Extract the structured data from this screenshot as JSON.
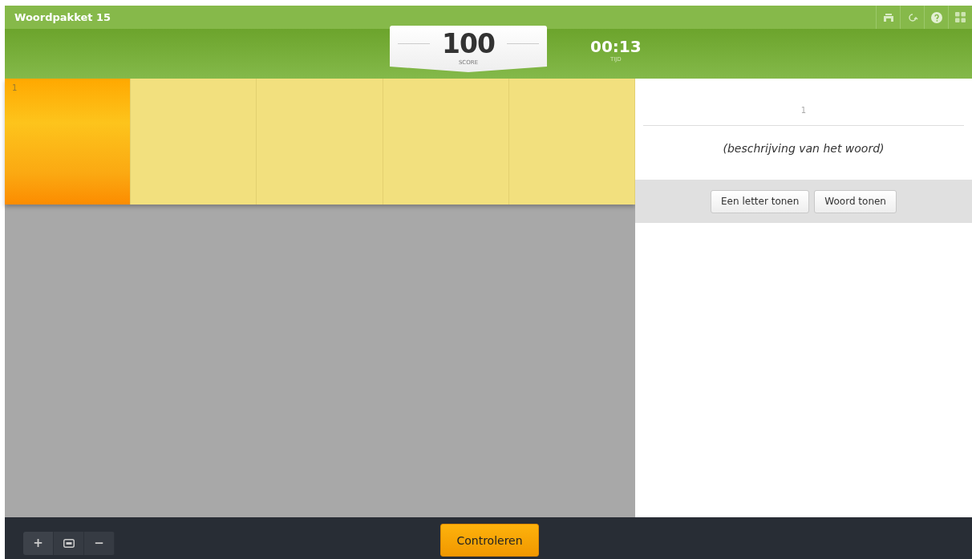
{
  "title": "Woordpakket 15",
  "score": {
    "value": "100",
    "label": "SCORE"
  },
  "time": {
    "value": "00:13",
    "label": "TIJD"
  },
  "grid": {
    "cells": [
      {
        "number": "1",
        "selected": true
      },
      {
        "selected": false
      },
      {
        "selected": false
      },
      {
        "selected": false
      },
      {
        "selected": false
      }
    ]
  },
  "clue": {
    "number": "1",
    "description": "(beschrijving van het woord)",
    "buttons": [
      "Een letter tonen",
      "Woord tonen"
    ]
  },
  "zoom_controls": {
    "zoom_in": "+",
    "zoom_out": "−"
  },
  "check_button": "Controleren"
}
